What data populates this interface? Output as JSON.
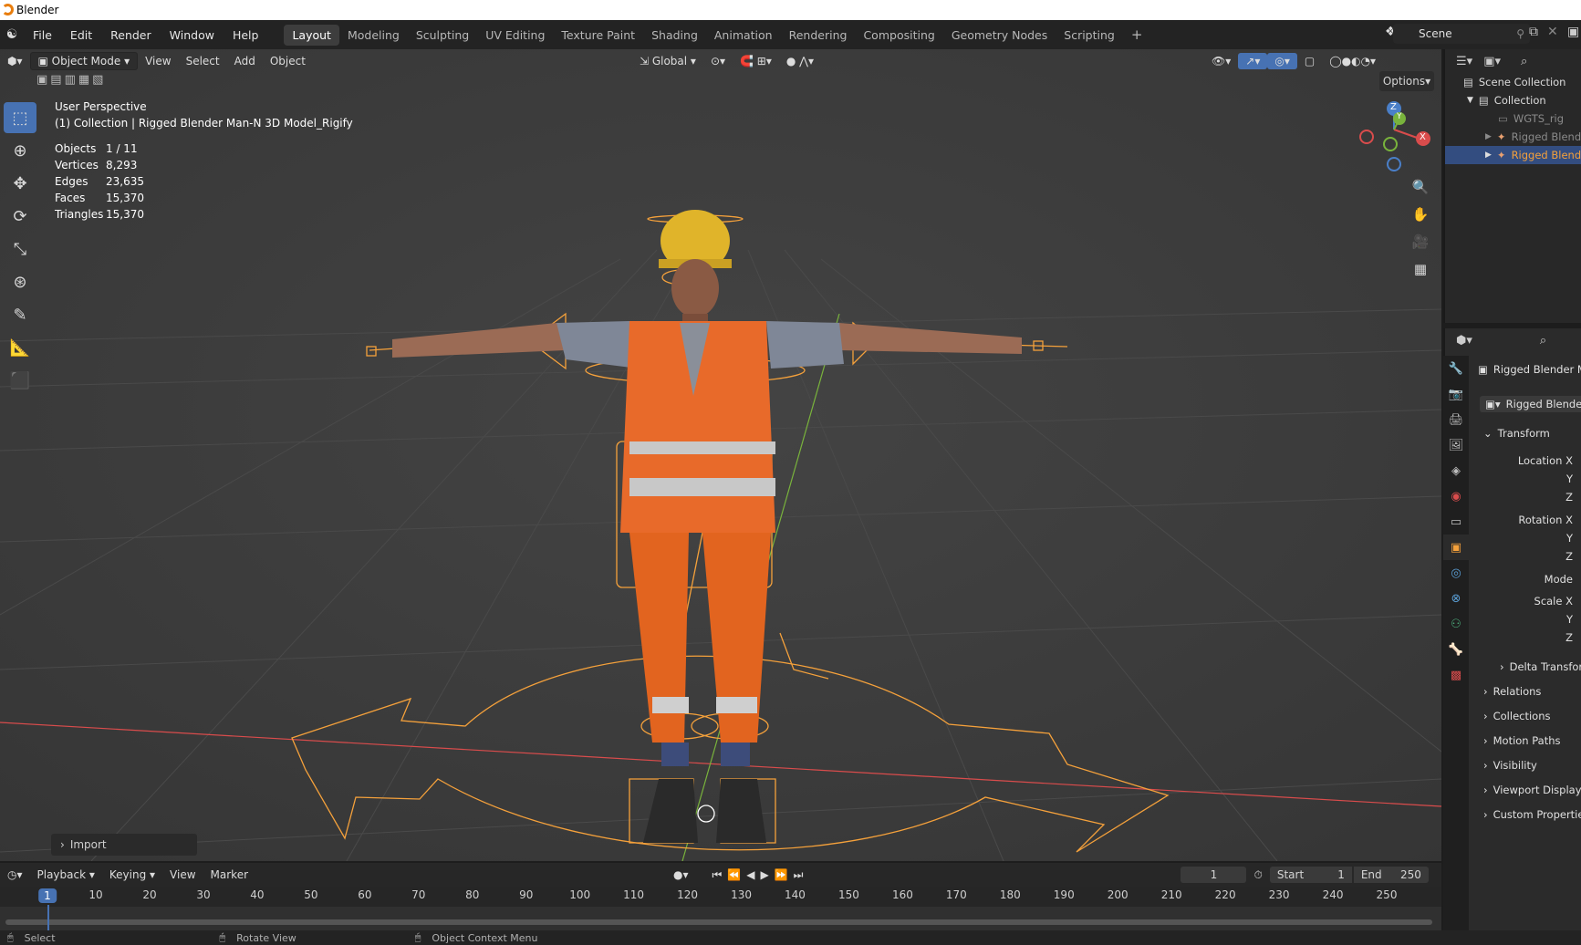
{
  "window": {
    "title": "Blender"
  },
  "menu": [
    "File",
    "Edit",
    "Render",
    "Window",
    "Help"
  ],
  "workspaces": [
    "Layout",
    "Modeling",
    "Sculpting",
    "UV Editing",
    "Texture Paint",
    "Shading",
    "Animation",
    "Rendering",
    "Compositing",
    "Geometry Nodes",
    "Scripting"
  ],
  "active_workspace": "Layout",
  "scene_name": "Scene",
  "viewport_header": {
    "mode": "Object Mode",
    "menus": [
      "View",
      "Select",
      "Add",
      "Object"
    ],
    "orientation": "Global",
    "options_label": "Options"
  },
  "viewport_info": {
    "view_name": "User Perspective",
    "context": "(1) Collection | Rigged Blender Man-N 3D Model_Rigify"
  },
  "stats": [
    {
      "label": "Objects",
      "value": "1 / 11"
    },
    {
      "label": "Vertices",
      "value": "8,293"
    },
    {
      "label": "Edges",
      "value": "23,635"
    },
    {
      "label": "Faces",
      "value": "15,370"
    },
    {
      "label": "Triangles",
      "value": "15,370"
    }
  ],
  "import_panel": "Import",
  "gizmo_axes": {
    "x": "X",
    "y": "Y",
    "z": "Z"
  },
  "outliner": {
    "rows": [
      {
        "label": "Scene Collection",
        "indent": 0
      },
      {
        "label": "Collection",
        "indent": 1
      },
      {
        "label": "WGTS_rig",
        "indent": 2
      },
      {
        "label": "Rigged Blend",
        "indent": 2
      },
      {
        "label": "Rigged Blend",
        "indent": 2,
        "selected": true
      }
    ]
  },
  "properties": {
    "object_name": "Rigged Blender M",
    "data_name": "Rigged Blender",
    "transform_header": "Transform",
    "fields": [
      "Location X",
      "Y",
      "Z",
      "Rotation X",
      "Y",
      "Z",
      "Mode",
      "Scale X",
      "Y",
      "Z"
    ],
    "delta_transform": "Delta Transform",
    "panels": [
      "Relations",
      "Collections",
      "Motion Paths",
      "Visibility",
      "Viewport Display",
      "Custom Properties"
    ]
  },
  "timeline": {
    "menus": [
      "Playback",
      "Keying",
      "View",
      "Marker"
    ],
    "current_frame": "1",
    "start_label": "Start",
    "start": "1",
    "end_label": "End",
    "end": "250",
    "frame_marks": [
      "1",
      "10",
      "20",
      "30",
      "40",
      "50",
      "60",
      "70",
      "80",
      "90",
      "100",
      "110",
      "120",
      "130",
      "140",
      "150",
      "160",
      "170",
      "180",
      "190",
      "200",
      "210",
      "220",
      "230",
      "240",
      "250"
    ]
  },
  "statusbar": [
    "Select",
    "Rotate View",
    "Object Context Menu"
  ],
  "colors": {
    "accent": "#4772b3",
    "selection": "#f5a13b",
    "x_axis": "#d94c4c",
    "y_axis": "#79b33c"
  }
}
